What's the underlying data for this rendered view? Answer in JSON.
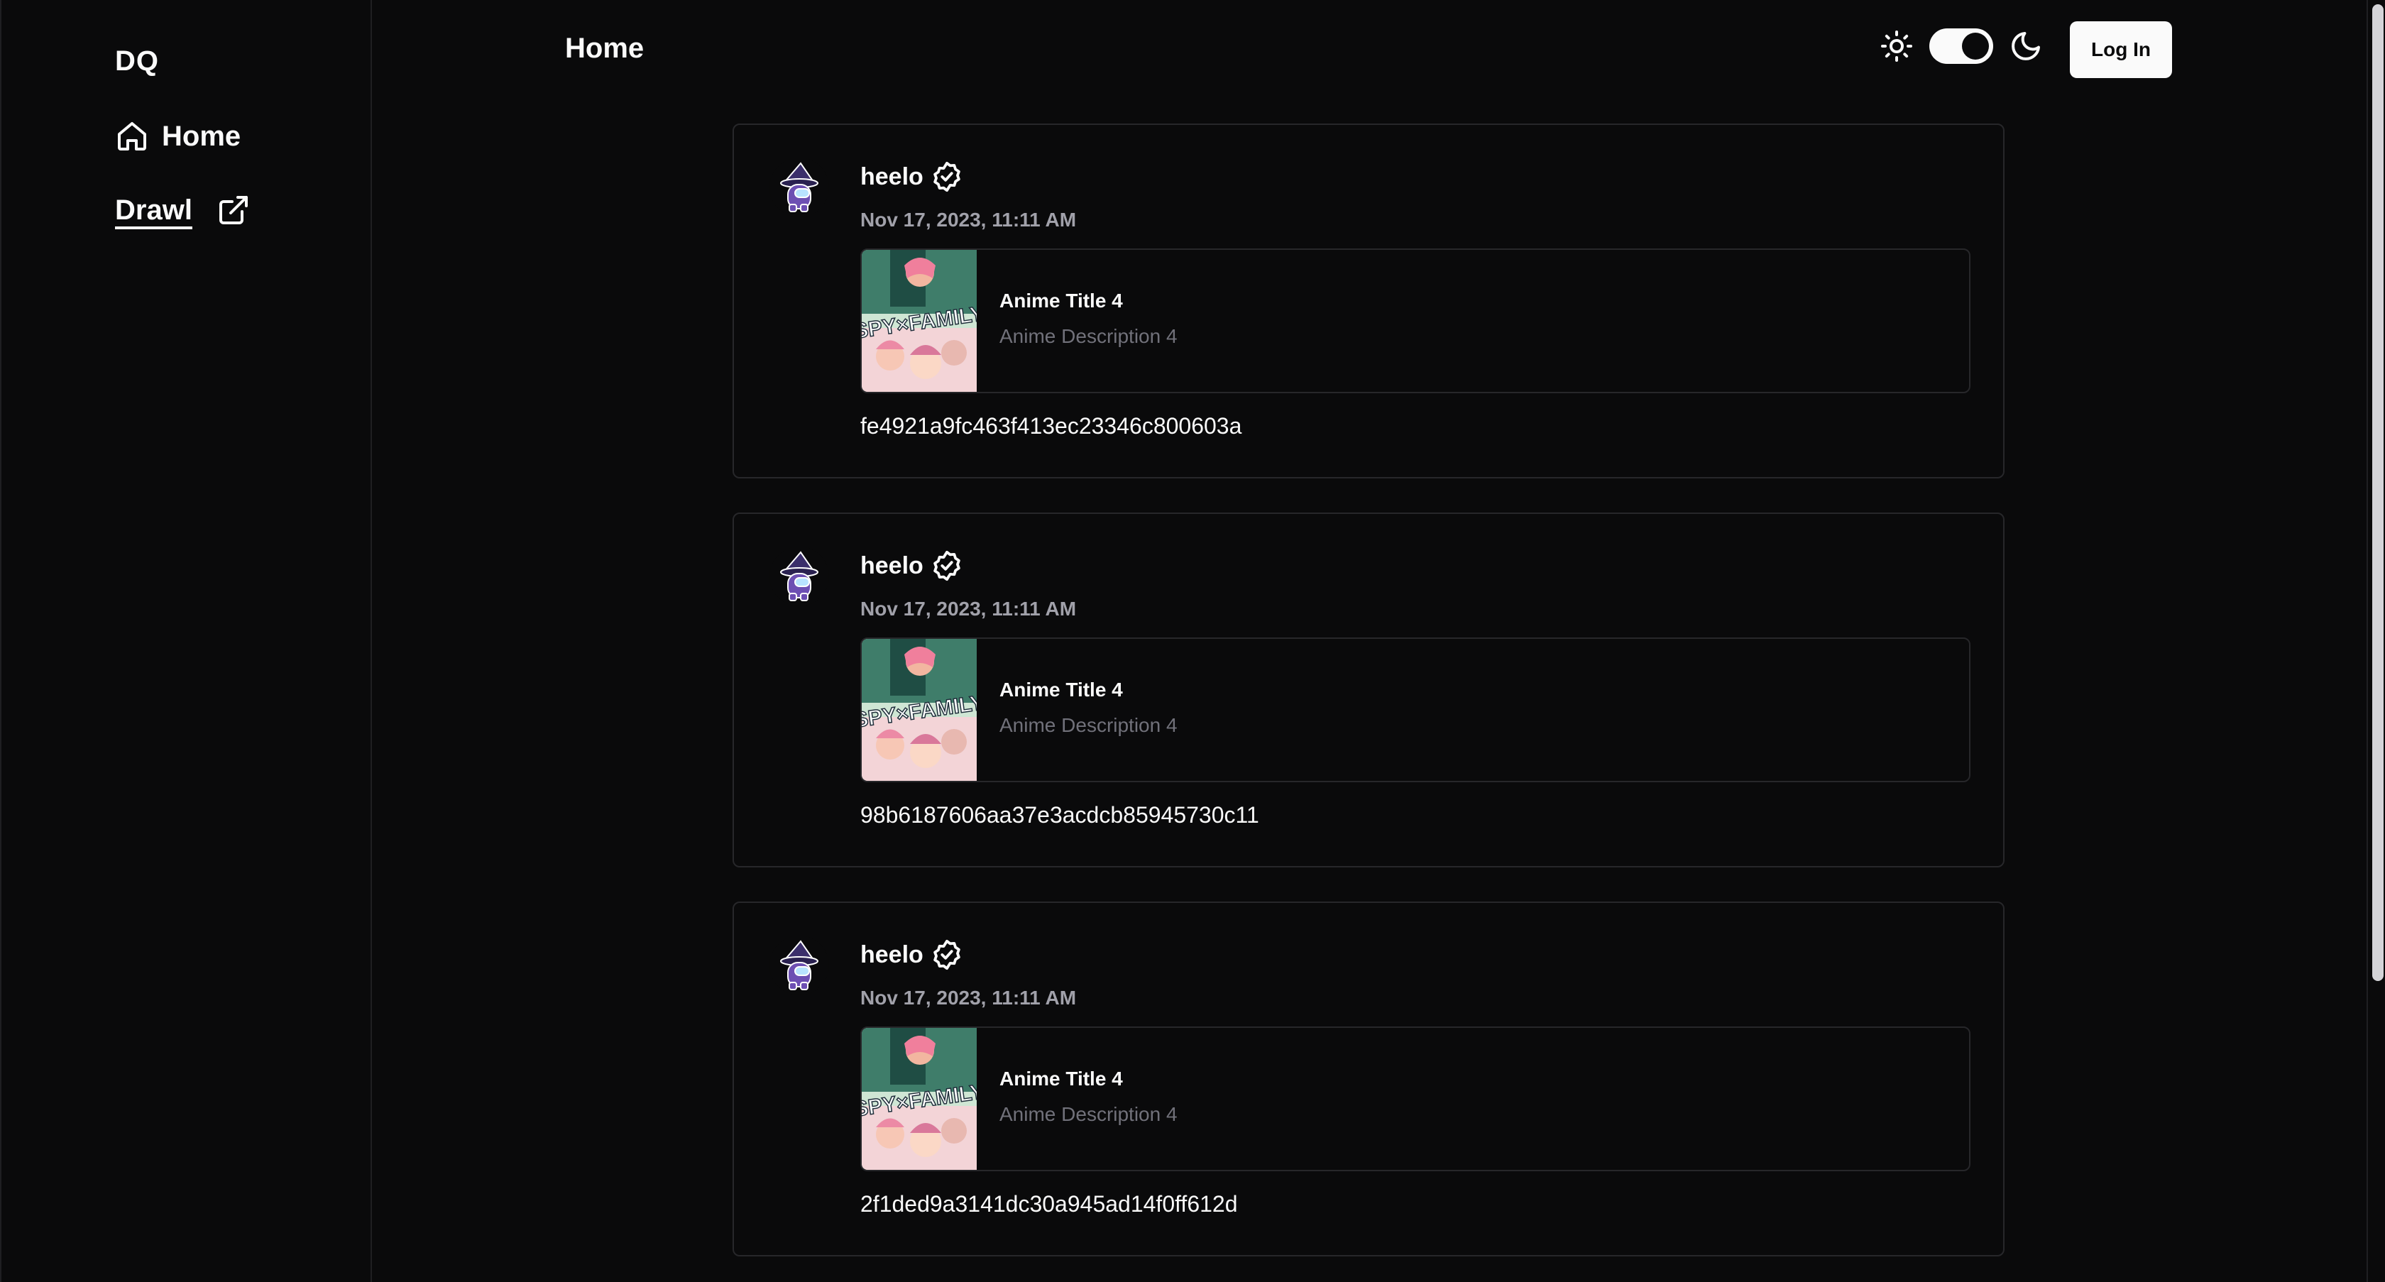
{
  "sidebar": {
    "brand": "DQ",
    "items": [
      {
        "label": "Home",
        "icon": "home-icon"
      },
      {
        "label": "Drawl",
        "icon": "external-link-icon"
      }
    ]
  },
  "header": {
    "title": "Home",
    "theme_toggle": {
      "left_icon": "sun-icon",
      "right_icon": "moon-icon",
      "state": "dark"
    },
    "login_label": "Log In"
  },
  "posts": [
    {
      "author": "heelo",
      "verified": true,
      "timestamp": "Nov 17, 2023, 11:11 AM",
      "anime": {
        "title": "Anime Title 4",
        "description": "Anime Description 4",
        "cover_text": "SPY×FAMILY"
      },
      "body": "fe4921a9fc463f413ec23346c800603a"
    },
    {
      "author": "heelo",
      "verified": true,
      "timestamp": "Nov 17, 2023, 11:11 AM",
      "anime": {
        "title": "Anime Title 4",
        "description": "Anime Description 4",
        "cover_text": "SPY×FAMILY"
      },
      "body": "98b6187606aa37e3acdcb85945730c11"
    },
    {
      "author": "heelo",
      "verified": true,
      "timestamp": "Nov 17, 2023, 11:11 AM",
      "anime": {
        "title": "Anime Title 4",
        "description": "Anime Description 4",
        "cover_text": "SPY×FAMILY"
      },
      "body": "2f1ded9a3141dc30a945ad14f0ff612d"
    }
  ],
  "colors": {
    "background": "#0a0a0b",
    "border": "#27272a",
    "muted_text": "#a1a1aa",
    "description_text": "#71717a",
    "avatar_purple": "#6d4fb3"
  }
}
